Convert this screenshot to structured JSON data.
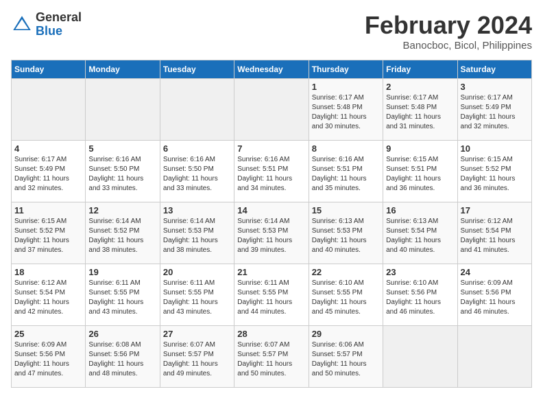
{
  "logo": {
    "general": "General",
    "blue": "Blue"
  },
  "title": "February 2024",
  "location": "Banocboc, Bicol, Philippines",
  "headers": [
    "Sunday",
    "Monday",
    "Tuesday",
    "Wednesday",
    "Thursday",
    "Friday",
    "Saturday"
  ],
  "weeks": [
    [
      {
        "day": "",
        "info": ""
      },
      {
        "day": "",
        "info": ""
      },
      {
        "day": "",
        "info": ""
      },
      {
        "day": "",
        "info": ""
      },
      {
        "day": "1",
        "info": "Sunrise: 6:17 AM\nSunset: 5:48 PM\nDaylight: 11 hours\nand 30 minutes."
      },
      {
        "day": "2",
        "info": "Sunrise: 6:17 AM\nSunset: 5:48 PM\nDaylight: 11 hours\nand 31 minutes."
      },
      {
        "day": "3",
        "info": "Sunrise: 6:17 AM\nSunset: 5:49 PM\nDaylight: 11 hours\nand 32 minutes."
      }
    ],
    [
      {
        "day": "4",
        "info": "Sunrise: 6:17 AM\nSunset: 5:49 PM\nDaylight: 11 hours\nand 32 minutes."
      },
      {
        "day": "5",
        "info": "Sunrise: 6:16 AM\nSunset: 5:50 PM\nDaylight: 11 hours\nand 33 minutes."
      },
      {
        "day": "6",
        "info": "Sunrise: 6:16 AM\nSunset: 5:50 PM\nDaylight: 11 hours\nand 33 minutes."
      },
      {
        "day": "7",
        "info": "Sunrise: 6:16 AM\nSunset: 5:51 PM\nDaylight: 11 hours\nand 34 minutes."
      },
      {
        "day": "8",
        "info": "Sunrise: 6:16 AM\nSunset: 5:51 PM\nDaylight: 11 hours\nand 35 minutes."
      },
      {
        "day": "9",
        "info": "Sunrise: 6:15 AM\nSunset: 5:51 PM\nDaylight: 11 hours\nand 36 minutes."
      },
      {
        "day": "10",
        "info": "Sunrise: 6:15 AM\nSunset: 5:52 PM\nDaylight: 11 hours\nand 36 minutes."
      }
    ],
    [
      {
        "day": "11",
        "info": "Sunrise: 6:15 AM\nSunset: 5:52 PM\nDaylight: 11 hours\nand 37 minutes."
      },
      {
        "day": "12",
        "info": "Sunrise: 6:14 AM\nSunset: 5:52 PM\nDaylight: 11 hours\nand 38 minutes."
      },
      {
        "day": "13",
        "info": "Sunrise: 6:14 AM\nSunset: 5:53 PM\nDaylight: 11 hours\nand 38 minutes."
      },
      {
        "day": "14",
        "info": "Sunrise: 6:14 AM\nSunset: 5:53 PM\nDaylight: 11 hours\nand 39 minutes."
      },
      {
        "day": "15",
        "info": "Sunrise: 6:13 AM\nSunset: 5:53 PM\nDaylight: 11 hours\nand 40 minutes."
      },
      {
        "day": "16",
        "info": "Sunrise: 6:13 AM\nSunset: 5:54 PM\nDaylight: 11 hours\nand 40 minutes."
      },
      {
        "day": "17",
        "info": "Sunrise: 6:12 AM\nSunset: 5:54 PM\nDaylight: 11 hours\nand 41 minutes."
      }
    ],
    [
      {
        "day": "18",
        "info": "Sunrise: 6:12 AM\nSunset: 5:54 PM\nDaylight: 11 hours\nand 42 minutes."
      },
      {
        "day": "19",
        "info": "Sunrise: 6:11 AM\nSunset: 5:55 PM\nDaylight: 11 hours\nand 43 minutes."
      },
      {
        "day": "20",
        "info": "Sunrise: 6:11 AM\nSunset: 5:55 PM\nDaylight: 11 hours\nand 43 minutes."
      },
      {
        "day": "21",
        "info": "Sunrise: 6:11 AM\nSunset: 5:55 PM\nDaylight: 11 hours\nand 44 minutes."
      },
      {
        "day": "22",
        "info": "Sunrise: 6:10 AM\nSunset: 5:55 PM\nDaylight: 11 hours\nand 45 minutes."
      },
      {
        "day": "23",
        "info": "Sunrise: 6:10 AM\nSunset: 5:56 PM\nDaylight: 11 hours\nand 46 minutes."
      },
      {
        "day": "24",
        "info": "Sunrise: 6:09 AM\nSunset: 5:56 PM\nDaylight: 11 hours\nand 46 minutes."
      }
    ],
    [
      {
        "day": "25",
        "info": "Sunrise: 6:09 AM\nSunset: 5:56 PM\nDaylight: 11 hours\nand 47 minutes."
      },
      {
        "day": "26",
        "info": "Sunrise: 6:08 AM\nSunset: 5:56 PM\nDaylight: 11 hours\nand 48 minutes."
      },
      {
        "day": "27",
        "info": "Sunrise: 6:07 AM\nSunset: 5:57 PM\nDaylight: 11 hours\nand 49 minutes."
      },
      {
        "day": "28",
        "info": "Sunrise: 6:07 AM\nSunset: 5:57 PM\nDaylight: 11 hours\nand 50 minutes."
      },
      {
        "day": "29",
        "info": "Sunrise: 6:06 AM\nSunset: 5:57 PM\nDaylight: 11 hours\nand 50 minutes."
      },
      {
        "day": "",
        "info": ""
      },
      {
        "day": "",
        "info": ""
      }
    ]
  ]
}
